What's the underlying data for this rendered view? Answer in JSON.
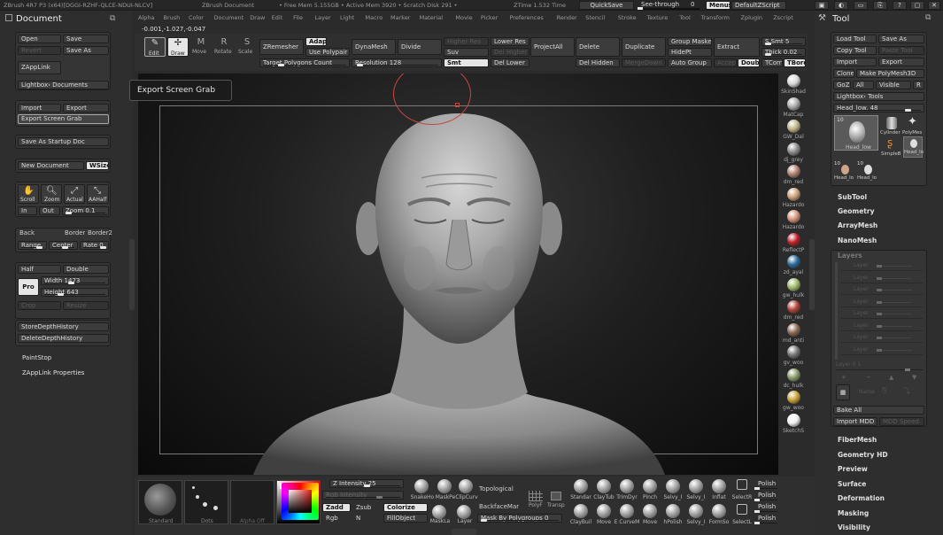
{
  "titlebar": {
    "app_title": "ZBrush 4R7 P3 (x64)[DGGI-RZHF-QLCE-NDUI-NLCV]",
    "doc_title": "ZBrush Document",
    "stats": "• Free Mem 5.155GB • Active Mem 3920 • Scratch Disk 291 •",
    "ztime": "ZTime 1.532 Time",
    "quicksave": "QuickSave",
    "seethrough": "See-through",
    "seethrough_val": "0",
    "menus": "Menus",
    "defaultzscript": "DefaultZScript"
  },
  "menubar": [
    "Alpha",
    "Brush",
    "Color",
    "Document",
    "Draw",
    "Edit",
    "File",
    "Layer",
    "Light",
    "Macro",
    "Marker",
    "Material",
    "Movie",
    "Picker",
    "Preferences",
    "Render",
    "Stencil",
    "Stroke",
    "Texture",
    "Tool",
    "Transform",
    "Zplugin",
    "Zscript"
  ],
  "coords": "-0.001,-1.027,-0.047",
  "left_panel": {
    "title": "Document",
    "open": "Open",
    "save": "Save",
    "revert": "Revert",
    "save_as": "Save As",
    "zapplink": "ZAppLink",
    "lightbox_docs": "Lightbox› Documents",
    "import": "Import",
    "export": "Export",
    "export_screen_grab": "Export Screen Grab",
    "save_startup": "Save As Startup Doc",
    "new_document": "New Document",
    "wsize": "WSize",
    "scroll": "Scroll",
    "zoom": "Zoom",
    "actual": "Actual",
    "aahalf": "AAHalf",
    "in": "In",
    "out": "Out",
    "zoom_val": "Zoom 0.1",
    "back": "Back",
    "border": "Border",
    "border2": "Border2",
    "range": "Range",
    "center": "Center",
    "rate": "Rate 0.",
    "half": "Half",
    "double": "Double",
    "pro": "Pro",
    "width": "Width 1473",
    "height": "Height 643",
    "crop": "Crop",
    "resize": "Resize",
    "store_depth": "StoreDepthHistory",
    "delete_depth": "DeleteDepthHistory",
    "paintstop": "PaintStop",
    "zapplink_props": "ZAppLink Properties"
  },
  "tooltip": "Export Screen Grab",
  "top_toolbar": {
    "edit": "Edit",
    "draw": "Draw",
    "move": "Move",
    "rotate": "Rotate",
    "scale": "Scale",
    "zremesher": "ZRemesher",
    "adap": "Adap",
    "use_polypaint": "Use Polypair",
    "target_polys": "Target Polygons Count",
    "dynamesh": "DynaMesh",
    "resolution": "Resolution 128",
    "divide": "Divide",
    "higher_res": "Higher Res",
    "suv": "Suv",
    "smt": "Smt",
    "lower_res": "Lower Res",
    "del_higher": "Del Higher",
    "del_lower": "Del Lower",
    "projectall": "ProjectAll",
    "delete": "Delete",
    "del_hidden": "Del Hidden",
    "duplicate": "Duplicate",
    "mergedown": "MergeDown",
    "group_masked": "Group Masked",
    "hidept": "HidePt",
    "auto_group": "Auto Group",
    "extract": "Extract",
    "accept": "Accep",
    "smt5": "S Smt 5",
    "thick": "Thick 0.02",
    "doub": "Doub",
    "tcorn": "TCorn",
    "tbord": "TBord"
  },
  "materials": [
    {
      "name": "SkinShad",
      "color": "#d8d8d8"
    },
    {
      "name": "MatCap",
      "color": "#aaaaaa"
    },
    {
      "name": "GW_Dal",
      "color": "#bfb48a"
    },
    {
      "name": "dj_grey",
      "color": "#8c8c8c"
    },
    {
      "name": "dm_red",
      "color": "#b08070"
    },
    {
      "name": "Hazardo",
      "color": "#c9a079"
    },
    {
      "name": "Hazardo",
      "color": "#d29478"
    },
    {
      "name": "ReflectP",
      "color": "#c0202a"
    },
    {
      "name": "zd_ayal",
      "color": "#2a6a9a"
    },
    {
      "name": "gw_hulk",
      "color": "#9fb86a"
    },
    {
      "name": "dm_red",
      "color": "#b0443a"
    },
    {
      "name": "md_anti",
      "color": "#8a6a55"
    },
    {
      "name": "gv_woo",
      "color": "#777777"
    },
    {
      "name": "dc_hulk",
      "color": "#8a9a6a"
    },
    {
      "name": "gw_woo",
      "color": "#c8a23a"
    },
    {
      "name": "SketchS",
      "color": "#f0f0f0"
    }
  ],
  "right_panel": {
    "title": "Tool",
    "load_tool": "Load Tool",
    "save_as": "Save As",
    "copy_tool": "Copy Tool",
    "paste_tool": "Paste Tool",
    "import": "Import",
    "export": "Export",
    "clone": "Clone",
    "make_polymesh": "Make PolyMesh3D",
    "goz": "GoZ",
    "all": "All",
    "visible": "Visible",
    "r": "R",
    "lightbox_tools": "Lightbox› Tools",
    "head_low": "Head_low. 48",
    "thumb_count": "10",
    "thumbs": [
      "Head_low",
      "Cylinder",
      "PolyMes",
      "SimpleB",
      "Head_lo",
      "Head_lo",
      "Head_lo"
    ],
    "subtool": "SubTool",
    "geometry": "Geometry",
    "arraymesh": "ArrayMesh",
    "nanomesh": "NanoMesh",
    "layers": "Layers",
    "layer_rows": [
      "Layer",
      "Layer",
      "Layer",
      "Layer",
      "Layer",
      "Layer",
      "Layer",
      "Layer"
    ],
    "layer_count": "Layer 0 1",
    "name": "Name",
    "bake_all": "Bake All",
    "import_mdd": "Import MDD",
    "mdd_speed": "MDD Speed",
    "sections": [
      "FiberMesh",
      "Geometry HD",
      "Preview",
      "Surface",
      "Deformation",
      "Masking",
      "Visibility"
    ]
  },
  "bottom": {
    "standard": "Standard",
    "dots": "Dots",
    "alpha_off": "Alpha Off",
    "z_intensity": "Z Intensity 25",
    "rgb_intensity": "Rgb Intensity",
    "zadd": "Zadd",
    "zsub": "Zsub",
    "rgb": "Rgb",
    "n": "N",
    "colorize": "Colorize",
    "fillobject": "FillObject",
    "snakehook": "SnakeHo",
    "maskpen": "MaskPe",
    "clipcurve": "ClipCurv",
    "masklasso": "MaskLa",
    "layer": "Layer",
    "topological": "Topological",
    "backfacemask": "BackfaceMar",
    "mask_by_polygroups": "Mask By Polygroups 0",
    "polyf": "PolyF",
    "transp": "Transp",
    "brushes_top": [
      "Standar",
      "ClayTub",
      "TrimDyr",
      "Pinch",
      "Selvy_I",
      "Selvy_I",
      "Inflat",
      "SelectR"
    ],
    "brushes_bot": [
      "ClayBuil",
      "Move",
      "E CurveM",
      "Move",
      "hPolish",
      "Selvy_I",
      "FormSo",
      "SelectL"
    ],
    "polish": "Polish"
  },
  "accent": "#e6e6e6",
  "brush_red": "#d94a4a"
}
